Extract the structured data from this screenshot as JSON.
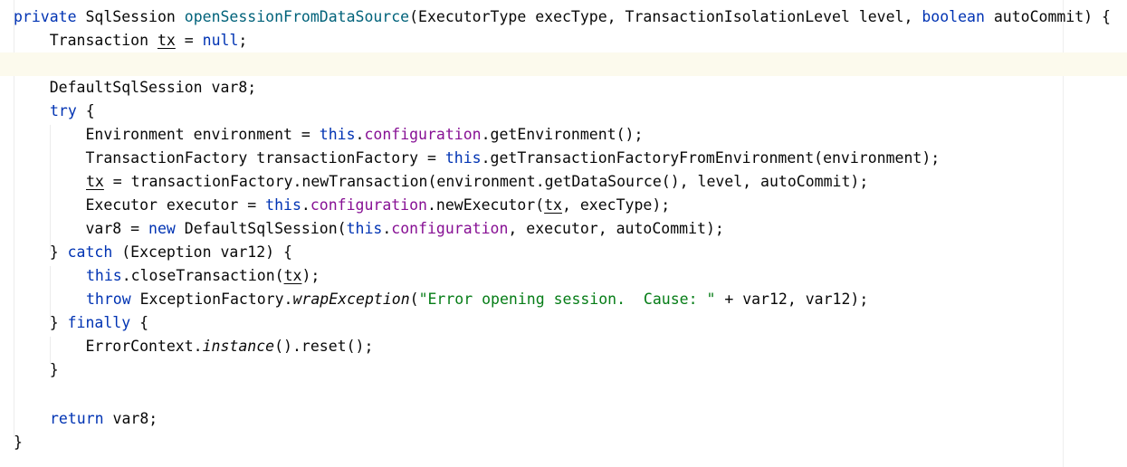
{
  "code": {
    "l1": {
      "kw_private": "private",
      "type": " SqlSession ",
      "method": "openSessionFromDataSource",
      "params_a": "(ExecutorType execType, TransactionIsolationLevel level, ",
      "kw_boolean": "boolean",
      "params_b": " autoCommit) {"
    },
    "l2": {
      "a": "    Transaction ",
      "var": "tx",
      "b": " = ",
      "kw_null": "null",
      "c": ";"
    },
    "l3": {
      "text": ""
    },
    "l4": {
      "text": "    DefaultSqlSession var8;"
    },
    "l5": {
      "kw_try": "try",
      "b": " {"
    },
    "l6": {
      "a": "        Environment environment = ",
      "kw_this": "this",
      "dot": ".",
      "field": "configuration",
      "b": ".getEnvironment();"
    },
    "l7": {
      "a": "        TransactionFactory transactionFactory = ",
      "kw_this": "this",
      "b": ".getTransactionFactoryFromEnvironment(environment);"
    },
    "l8": {
      "var": "tx",
      "b": " = transactionFactory.newTransaction(environment.getDataSource(), level, autoCommit);"
    },
    "l9": {
      "a": "        Executor executor = ",
      "kw_this": "this",
      "dot": ".",
      "field": "configuration",
      "b": ".newExecutor(",
      "var": "tx",
      "c": ", execType);"
    },
    "l10": {
      "a": "        var8 = ",
      "kw_new": "new",
      "b": " DefaultSqlSession(",
      "kw_this": "this",
      "dot": ".",
      "field": "configuration",
      "c": ", executor, autoCommit);"
    },
    "l11": {
      "a": "    } ",
      "kw_catch": "catch",
      "b": " (Exception var12) {"
    },
    "l12": {
      "kw_this": "this",
      "b": ".closeTransaction(",
      "var": "tx",
      "c": ");"
    },
    "l13": {
      "kw_throw": "throw",
      "b": " ExceptionFactory.",
      "static": "wrapException",
      "c": "(",
      "str": "\"Error opening session.  Cause: \"",
      "d": " + var12, var12);"
    },
    "l14": {
      "a": "    } ",
      "kw_finally": "finally",
      "b": " {"
    },
    "l15": {
      "a": "        ErrorContext.",
      "static": "instance",
      "b": "().reset();"
    },
    "l16": {
      "text": "    }"
    },
    "l17": {
      "text": ""
    },
    "l18": {
      "kw_return": "return",
      "b": " var8;"
    },
    "l19": {
      "text": "}"
    }
  }
}
